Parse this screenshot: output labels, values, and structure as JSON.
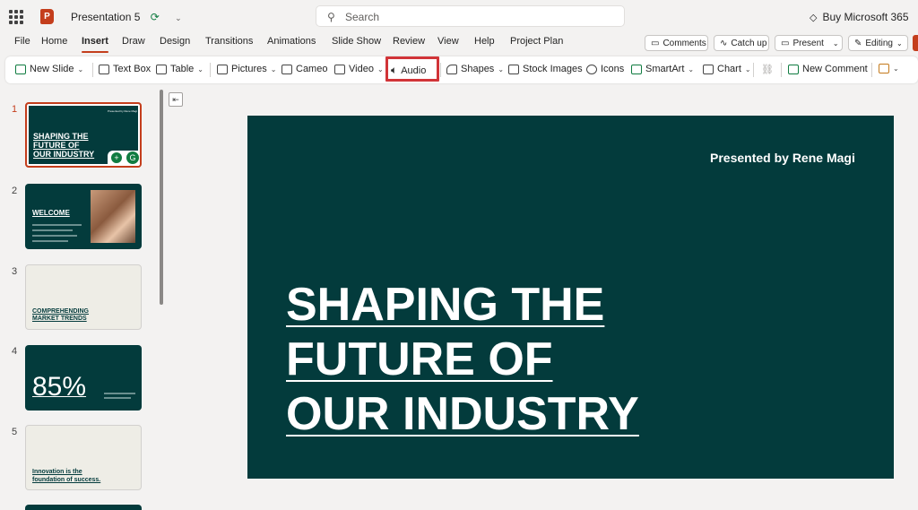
{
  "titlebar": {
    "app_logo_letter": "P",
    "doc_title": "Presentation 5",
    "search_placeholder": "Search",
    "buy_label": "Buy Microsoft 365"
  },
  "tabs": [
    "File",
    "Home",
    "Insert",
    "Draw",
    "Design",
    "Transitions",
    "Animations",
    "Slide Show",
    "Review",
    "View",
    "Help",
    "Project Plan"
  ],
  "active_tab": "Insert",
  "right_buttons": {
    "comments": "Comments",
    "catchup": "Catch up",
    "present": "Present",
    "editing": "Editing"
  },
  "ribbon": {
    "new_slide": "New Slide",
    "text_box": "Text Box",
    "table": "Table",
    "pictures": "Pictures",
    "cameo": "Cameo",
    "video": "Video",
    "audio": "Audio",
    "shapes": "Shapes",
    "stock_images": "Stock Images",
    "icons": "Icons",
    "smartart": "SmartArt",
    "chart": "Chart",
    "new_comment": "New Comment"
  },
  "thumbnails": [
    {
      "num": "1",
      "title_lines": [
        "SHAPING THE",
        "FUTURE OF",
        "OUR INDUSTRY"
      ],
      "top_text": "Presented by Rene Magi"
    },
    {
      "num": "2",
      "title": "WELCOME"
    },
    {
      "num": "3",
      "title_lines": [
        "COMPREHENDING",
        "MARKET TRENDS"
      ]
    },
    {
      "num": "4",
      "big_number": "85%"
    },
    {
      "num": "5",
      "title_lines": [
        "Innovation is the",
        "foundation of success."
      ]
    }
  ],
  "slide": {
    "presenter": "Presented by Rene Magi",
    "headline_lines": [
      "SHAPING THE",
      "FUTURE OF",
      "OUR INDUSTRY"
    ]
  },
  "colors": {
    "accent": "#c43e1c",
    "slide_bg": "#033b3c",
    "highlight": "#d13438"
  }
}
